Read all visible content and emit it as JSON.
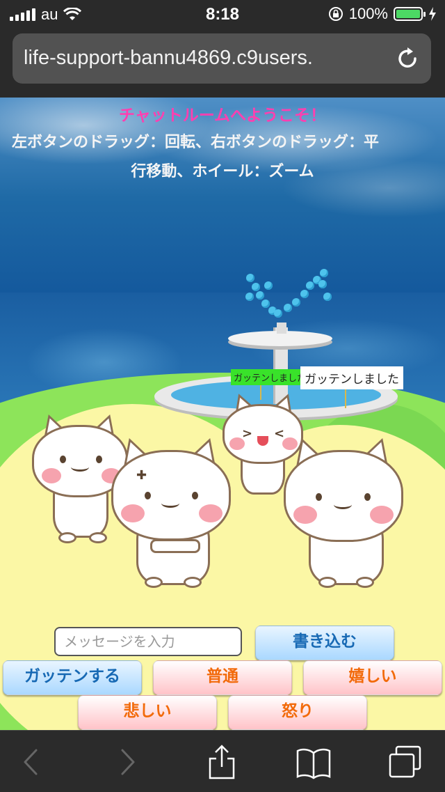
{
  "status_bar": {
    "carrier": "au",
    "time": "8:18",
    "battery_percent": "100%",
    "battery_level": 1.0,
    "battery_color": "#4cd964"
  },
  "browser": {
    "url": "life-support-bannu4869.c9users.",
    "reload_icon": "reload-icon"
  },
  "scene": {
    "title": "チャットルームへようこそ！",
    "help_line1": "左ボタンのドラッグ：回転、右ボタンのドラッグ：平",
    "help_line2": "行移動、ホイール：ズーム",
    "speech_bubble_1": "ガッテンしました",
    "speech_bubble_2": "ガッテンしました"
  },
  "chat_controls": {
    "message_placeholder": "メッセージを入力",
    "message_value": "",
    "submit_label": "書き込む",
    "agree_label": "ガッテンする",
    "emotion_normal": "普通",
    "emotion_happy": "嬉しい",
    "emotion_sad": "悲しい",
    "emotion_angry": "怒り"
  },
  "toolbar": {
    "icons": [
      "back-icon",
      "forward-icon",
      "share-icon",
      "bookmarks-icon",
      "tabs-icon"
    ]
  },
  "colors": {
    "title_pink": "#ff3fb0",
    "button_blue_text": "#1769b4",
    "button_pink_text": "#f26a0a"
  }
}
